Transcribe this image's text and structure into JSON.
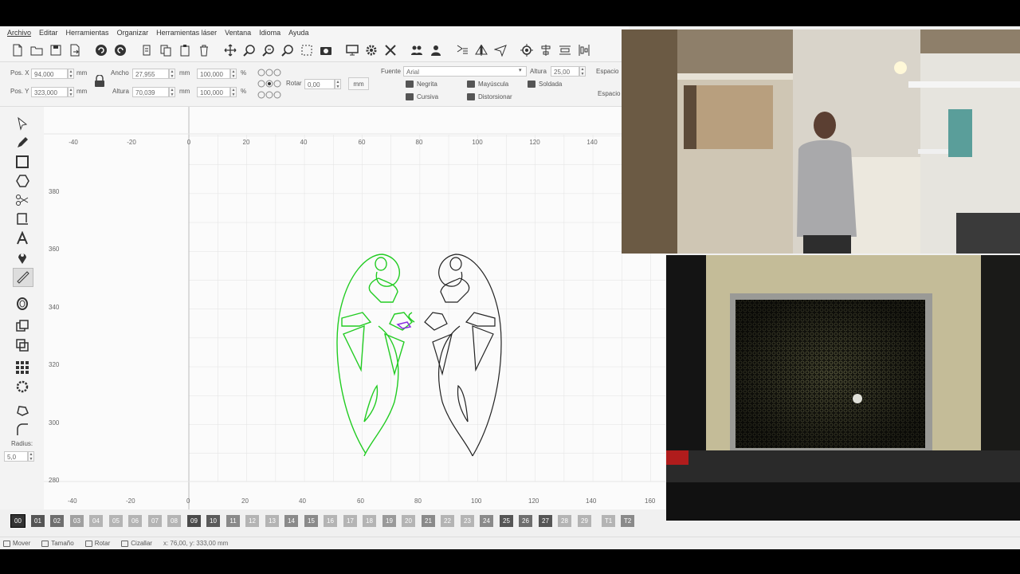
{
  "menu": [
    "Archivo",
    "Editar",
    "Herramientas",
    "Organizar",
    "Herramientas láser",
    "Ventana",
    "Idioma",
    "Ayuda"
  ],
  "toolbar_icons": [
    "new-file",
    "open-folder",
    "save",
    "export",
    "undo",
    "redo",
    "cut",
    "copy",
    "paste",
    "delete",
    "move",
    "zoom-in",
    "zoom-out",
    "zoom-fit",
    "frame-select",
    "camera",
    "monitor",
    "settings",
    "tools",
    "users",
    "user",
    "mirror-h",
    "mirror-v",
    "send",
    "target",
    "align",
    "distribute",
    "align-v"
  ],
  "props": {
    "pos_x_label": "Pos. X",
    "pos_x_value": "94,000",
    "pos_y_label": "Pos. Y",
    "pos_y_value": "323,000",
    "unit_mm": "mm",
    "width_label": "Ancho",
    "width_value": "27,955",
    "height_label": "Altura",
    "height_value": "70,039",
    "width_pct": "100,000",
    "height_pct": "100,000",
    "pct": "%",
    "rotate_label": "Rotar",
    "rotate_value": "0,00",
    "mm_button": "mm",
    "font_label": "Fuente",
    "font_value": "Arial",
    "font_height_label": "Altura",
    "font_height_value": "25,00",
    "spacing_label": "Espacio",
    "spacing_label2": "Espacio",
    "bold": "Negrita",
    "italic": "Cursiva",
    "uppercase": "Mayúscula",
    "distort": "Distorsionar",
    "weld": "Soldada"
  },
  "left_tools": [
    "select",
    "pencil",
    "rectangle",
    "polygon",
    "cut-scissors",
    "crop",
    "text",
    "marker-pin",
    "measure",
    "offset",
    "copy-shape",
    "boolean",
    "grid-array",
    "circular-array",
    "node-edit",
    "corner-round"
  ],
  "radius_label": "Radius:",
  "radius_value": "5,0",
  "ruler": {
    "x_ticks_top": [
      "-40",
      "-20",
      "0",
      "20",
      "40",
      "60",
      "80",
      "100",
      "120",
      "140"
    ],
    "x_ticks_bottom": [
      "-40",
      "-20",
      "0",
      "20",
      "40",
      "60",
      "80",
      "100",
      "120",
      "140",
      "160"
    ],
    "y_ticks": [
      "380",
      "360",
      "340",
      "320",
      "300",
      "280"
    ]
  },
  "layers": [
    {
      "label": "00",
      "color": "#333333"
    },
    {
      "label": "01",
      "color": "#555555"
    },
    {
      "label": "02",
      "color": "#6e6e6e"
    },
    {
      "label": "03",
      "color": "#a0a0a0"
    },
    {
      "label": "04",
      "color": "#b4b4b4"
    },
    {
      "label": "05",
      "color": "#b4b4b4"
    },
    {
      "label": "06",
      "color": "#b4b4b4"
    },
    {
      "label": "07",
      "color": "#b4b4b4"
    },
    {
      "label": "08",
      "color": "#b4b4b4"
    },
    {
      "label": "09",
      "color": "#4a4a4a"
    },
    {
      "label": "10",
      "color": "#5a5a5a"
    },
    {
      "label": "11",
      "color": "#8a8a8a"
    },
    {
      "label": "12",
      "color": "#b4b4b4"
    },
    {
      "label": "13",
      "color": "#b4b4b4"
    },
    {
      "label": "14",
      "color": "#8a8a8a"
    },
    {
      "label": "15",
      "color": "#8a8a8a"
    },
    {
      "label": "16",
      "color": "#b4b4b4"
    },
    {
      "label": "17",
      "color": "#b4b4b4"
    },
    {
      "label": "18",
      "color": "#b4b4b4"
    },
    {
      "label": "19",
      "color": "#9a9a9a"
    },
    {
      "label": "20",
      "color": "#b4b4b4"
    },
    {
      "label": "21",
      "color": "#8a8a8a"
    },
    {
      "label": "22",
      "color": "#b4b4b4"
    },
    {
      "label": "23",
      "color": "#b4b4b4"
    },
    {
      "label": "24",
      "color": "#8a8a8a"
    },
    {
      "label": "25",
      "color": "#555555"
    },
    {
      "label": "26",
      "color": "#6e6e6e"
    },
    {
      "label": "27",
      "color": "#555555"
    },
    {
      "label": "28",
      "color": "#b4b4b4"
    },
    {
      "label": "29",
      "color": "#b4b4b4"
    },
    {
      "label": "T1",
      "color": "#b4b4b4"
    },
    {
      "label": "T2",
      "color": "#8a8a8a"
    }
  ],
  "status": {
    "move": "Mover",
    "size": "Tamaño",
    "rotate": "Rotar",
    "shear": "Cizallar",
    "coords": "x: 76,00, y: 333,00 mm"
  },
  "colors": {
    "selected_shape": "#22cc22",
    "shape": "#222222",
    "accent_marker": "#8a2be2"
  }
}
